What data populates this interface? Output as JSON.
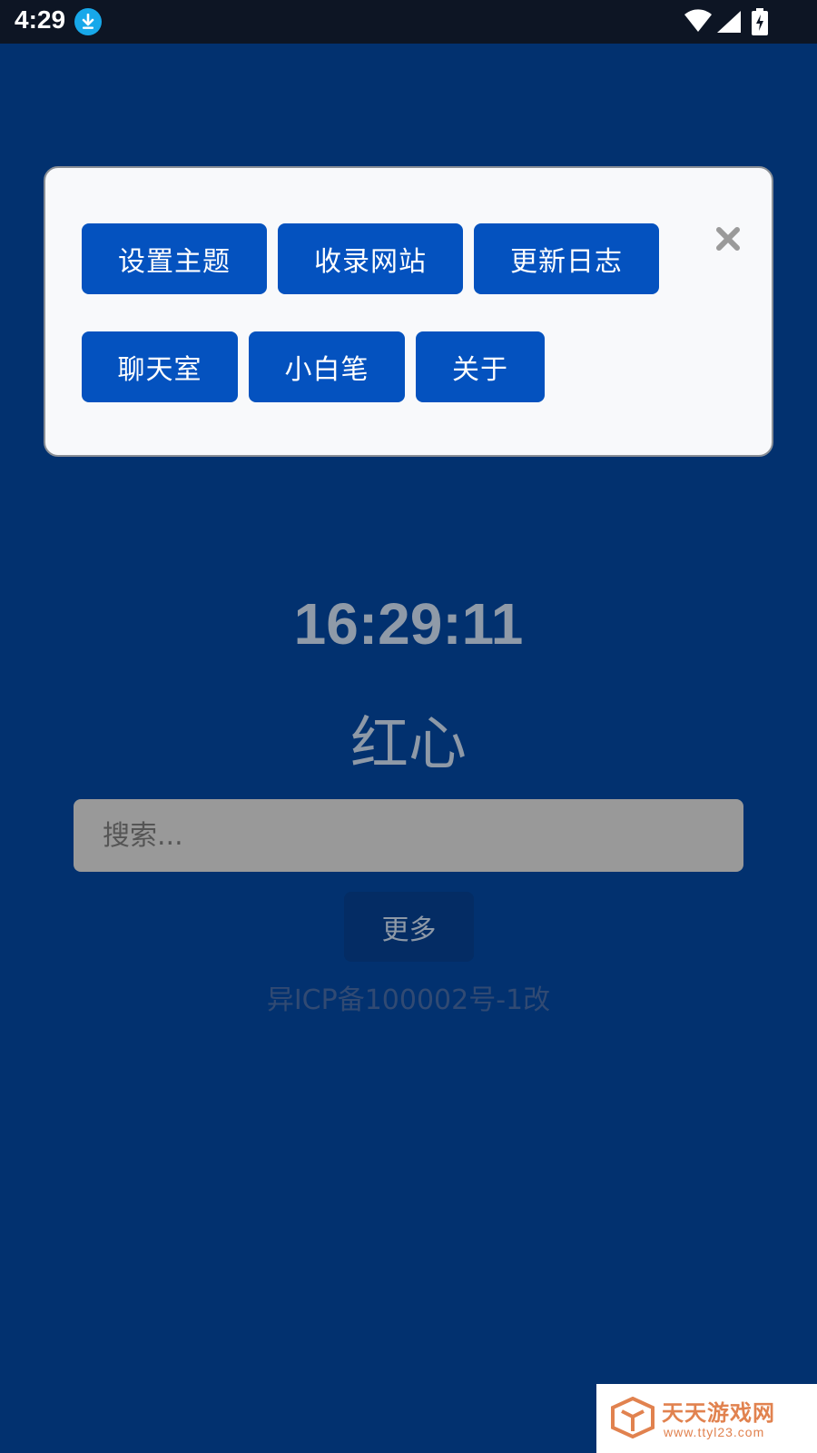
{
  "status_bar": {
    "time": "4:29",
    "icons": [
      "download-icon",
      "wifi-icon",
      "signal-icon",
      "battery-charging-icon"
    ]
  },
  "menu": {
    "buttons": [
      "设置主题",
      "收录网站",
      "更新日志",
      "聊天室",
      "小白笔",
      "关于"
    ],
    "close_icon": "close-icon"
  },
  "main": {
    "clock": "16:29:11",
    "heading": "红心",
    "search_placeholder": "搜索...",
    "more_label": "更多",
    "icp": "异ICP备100002号-1改"
  },
  "watermark": {
    "title": "天天游戏网",
    "url": "www.ttyl23.com"
  },
  "colors": {
    "background": "#02316f",
    "status_bar": "#0d1524",
    "menu_button": "#0452bf",
    "menu_card": "#f8f9fb",
    "text_muted": "#8e99a7",
    "search_bg": "#999999"
  }
}
